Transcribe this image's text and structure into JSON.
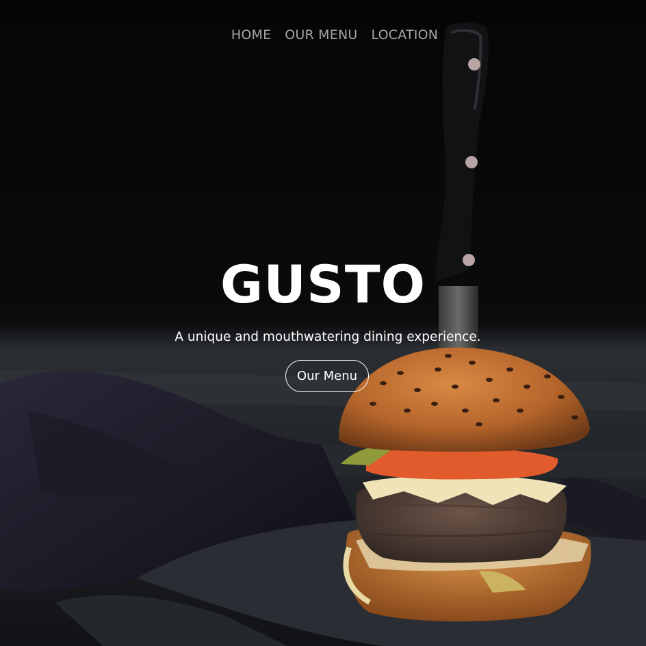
{
  "nav": {
    "items": [
      {
        "label": "HOME"
      },
      {
        "label": "OUR MENU"
      },
      {
        "label": "LOCATION"
      }
    ]
  },
  "hero": {
    "title": "GUSTO",
    "tagline": "A unique and mouthwatering dining experience.",
    "cta_label": "Our Menu",
    "photo": "burger-with-knife-on-slate"
  },
  "colors": {
    "background": "#000000",
    "nav_text": "#a6a6a6",
    "hero_text": "#ffffff"
  }
}
